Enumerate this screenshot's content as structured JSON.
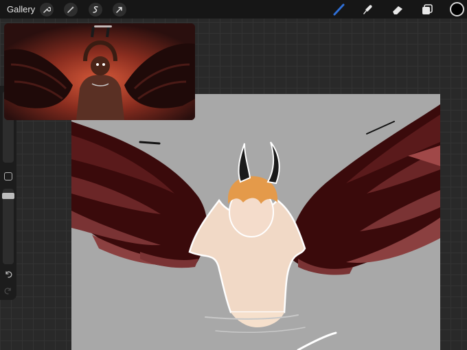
{
  "topbar": {
    "gallery_label": "Gallery",
    "left_tools": [
      "wrench-icon",
      "magic-wand-icon",
      "selection-icon",
      "transform-arrow-icon"
    ],
    "right_tools": [
      "brush-icon",
      "smudge-icon",
      "eraser-icon",
      "layers-icon"
    ],
    "active_tool": "brush-icon",
    "brush_color": "#2f6fd6",
    "current_color": "#000000"
  },
  "sidebar": {
    "tools": [
      "brush-size-slider",
      "modify-button",
      "opacity-slider",
      "undo-icon",
      "redo-icon"
    ]
  },
  "canvas": {
    "background": "#a8a8a8"
  },
  "reference": {
    "colors": [
      "#2a0f0e",
      "#8a2d1f",
      "#d85a3a"
    ]
  }
}
